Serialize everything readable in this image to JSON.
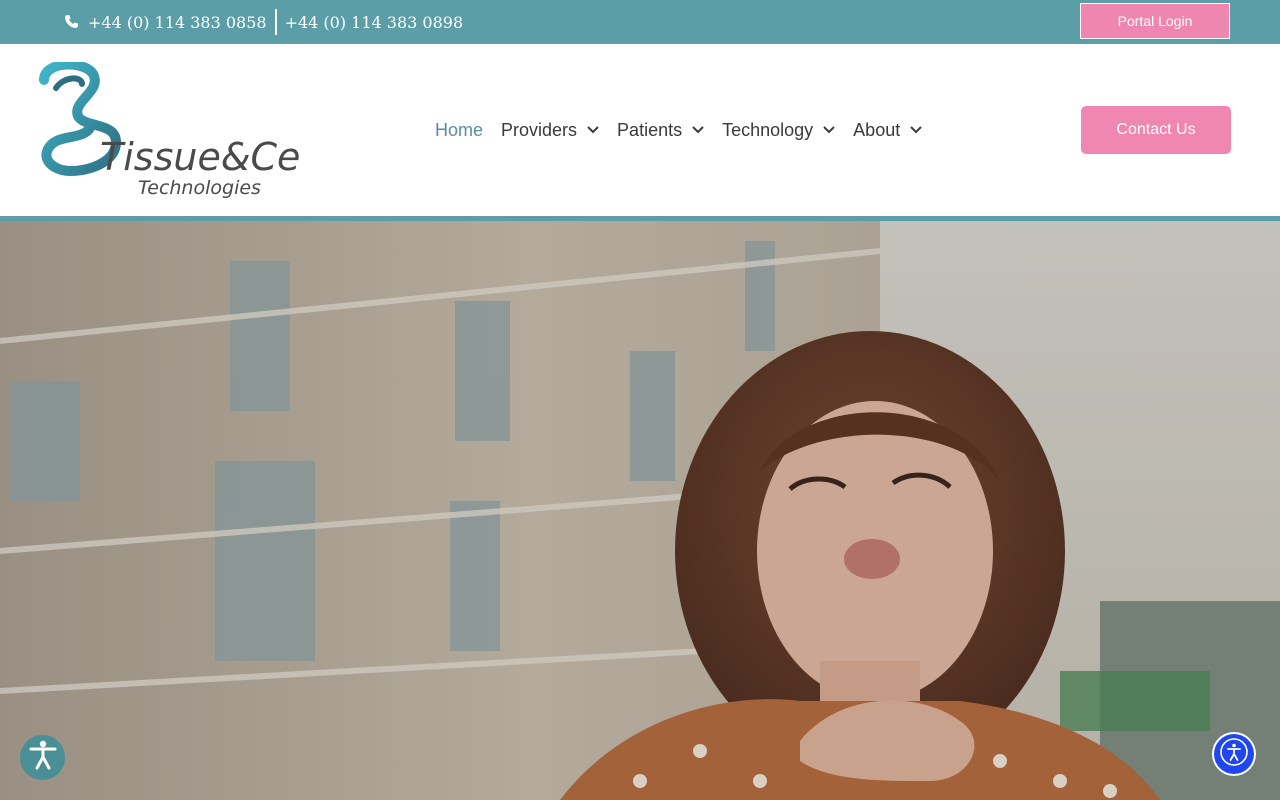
{
  "topbar": {
    "phone_primary": "+44 (0) 114 383 0858",
    "phone_secondary": "+44 (0) 114 383 0898",
    "portal_label": "Portal Login",
    "phone_icon": "phone-icon"
  },
  "brand": {
    "name_line1": "Tissue&Cell",
    "name_line2": "Technologies"
  },
  "nav": {
    "items": [
      {
        "label": "Home",
        "active": true
      },
      {
        "label": "Providers",
        "dropdown": true
      },
      {
        "label": "Patients",
        "dropdown": true
      },
      {
        "label": "Technology",
        "dropdown": true
      },
      {
        "label": "About",
        "dropdown": true
      }
    ],
    "contact_label": "Contact Us"
  },
  "colors": {
    "teal": "#5b9ea8",
    "pink": "#f086b2",
    "nav_text": "#3a3a3a",
    "nav_active": "#5b8e99",
    "a11y_blue": "#2046f0"
  },
  "widgets": {
    "left_icon": "accessibility-person-icon",
    "right_icon": "accessibility-person-icon"
  }
}
